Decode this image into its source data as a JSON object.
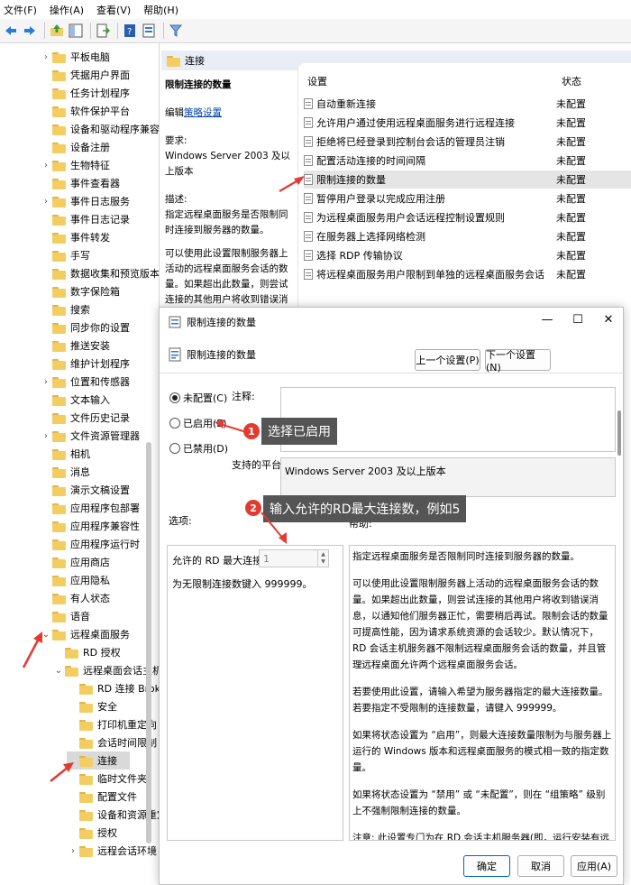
{
  "menu": [
    "文件(F)",
    "操作(A)",
    "查看(V)",
    "帮助(H)"
  ],
  "tree": {
    "items": [
      {
        "label": "平板电脑",
        "expander": "›",
        "level": 1
      },
      {
        "label": "凭据用户界面",
        "expander": "",
        "level": 1
      },
      {
        "label": "任务计划程序",
        "expander": "",
        "level": 1
      },
      {
        "label": "软件保护平台",
        "expander": "",
        "level": 1
      },
      {
        "label": "设备和驱动程序兼容性",
        "expander": "",
        "level": 1
      },
      {
        "label": "设备注册",
        "expander": "",
        "level": 1
      },
      {
        "label": "生物特征",
        "expander": "›",
        "level": 1
      },
      {
        "label": "事件查看器",
        "expander": "",
        "level": 1
      },
      {
        "label": "事件日志服务",
        "expander": "›",
        "level": 1
      },
      {
        "label": "事件日志记录",
        "expander": "",
        "level": 1
      },
      {
        "label": "事件转发",
        "expander": "",
        "level": 1
      },
      {
        "label": "手写",
        "expander": "",
        "level": 1
      },
      {
        "label": "数据收集和预览版本",
        "expander": "",
        "level": 1
      },
      {
        "label": "数字保险箱",
        "expander": "",
        "level": 1
      },
      {
        "label": "搜索",
        "expander": "",
        "level": 1
      },
      {
        "label": "同步你的设置",
        "expander": "",
        "level": 1
      },
      {
        "label": "推送安装",
        "expander": "",
        "level": 1
      },
      {
        "label": "维护计划程序",
        "expander": "",
        "level": 1
      },
      {
        "label": "位置和传感器",
        "expander": "›",
        "level": 1
      },
      {
        "label": "文本输入",
        "expander": "",
        "level": 1
      },
      {
        "label": "文件历史记录",
        "expander": "",
        "level": 1
      },
      {
        "label": "文件资源管理器",
        "expander": "›",
        "level": 1
      },
      {
        "label": "相机",
        "expander": "",
        "level": 1
      },
      {
        "label": "消息",
        "expander": "",
        "level": 1
      },
      {
        "label": "演示文稿设置",
        "expander": "",
        "level": 1
      },
      {
        "label": "应用程序包部署",
        "expander": "",
        "level": 1
      },
      {
        "label": "应用程序兼容性",
        "expander": "",
        "level": 1
      },
      {
        "label": "应用程序运行时",
        "expander": "",
        "level": 1
      },
      {
        "label": "应用商店",
        "expander": "",
        "level": 1
      },
      {
        "label": "应用隐私",
        "expander": "",
        "level": 1
      },
      {
        "label": "有人状态",
        "expander": "",
        "level": 1
      },
      {
        "label": "语音",
        "expander": "",
        "level": 1
      },
      {
        "label": "远程桌面服务",
        "expander": "⌄",
        "level": 1
      },
      {
        "label": "RD 授权",
        "expander": "",
        "level": 2
      },
      {
        "label": "远程桌面会话主机",
        "expander": "⌄",
        "level": 2
      },
      {
        "label": "RD 连接 Broker",
        "expander": "",
        "level": 3
      },
      {
        "label": "安全",
        "expander": "",
        "level": 3
      },
      {
        "label": "打印机重定向",
        "expander": "",
        "level": 3
      },
      {
        "label": "会话时间限制",
        "expander": "",
        "level": 3
      },
      {
        "label": "连接",
        "expander": "",
        "level": 3,
        "selected": true
      },
      {
        "label": "临时文件夹",
        "expander": "",
        "level": 3
      },
      {
        "label": "配置文件",
        "expander": "",
        "level": 3
      },
      {
        "label": "设备和资源重定向",
        "expander": "",
        "level": 3
      },
      {
        "label": "授权",
        "expander": "",
        "level": 3
      },
      {
        "label": "远程会话环境",
        "expander": "›",
        "level": 3
      }
    ]
  },
  "right": {
    "header": "连接",
    "desc": {
      "title": "限制连接的数量",
      "edit_prefix": "编辑",
      "edit_link": "策略设置",
      "req_label": "要求:",
      "req_value": "Windows Server 2003 及以上版本",
      "desc_label": "描述:",
      "desc_text": "指定远程桌面服务是否限制同时连接到服务器的数量。",
      "desc_more": "可以使用此设置限制服务器上活动的远程桌面服务会话的数量。如果超出此数量，则尝试连接的其他用户将收到错误消息，以通知他们服务器正"
    },
    "list": {
      "col_setting": "设置",
      "col_status": "状态",
      "rows": [
        {
          "name": "自动重新连接",
          "status": "未配置"
        },
        {
          "name": "允许用户通过使用远程桌面服务进行远程连接",
          "status": "未配置"
        },
        {
          "name": "拒绝将已经登录到控制台会话的管理员注销",
          "status": "未配置"
        },
        {
          "name": "配置活动连接的时间间隔",
          "status": "未配置"
        },
        {
          "name": "限制连接的数量",
          "status": "未配置",
          "selected": true
        },
        {
          "name": "暂停用户登录以完成应用注册",
          "status": "未配置"
        },
        {
          "name": "为远程桌面服务用户会话远程控制设置规则",
          "status": "未配置"
        },
        {
          "name": "在服务器上选择网络检测",
          "status": "未配置"
        },
        {
          "name": "选择 RDP 传输协议",
          "status": "未配置"
        },
        {
          "name": "将远程桌面服务用户限制到单独的远程桌面服务会话",
          "status": "未配置"
        }
      ]
    }
  },
  "dialog": {
    "title": "限制连接的数量",
    "subtitle": "限制连接的数量",
    "prev_button": "上一个设置(P)",
    "next_button": "下一个设置(N)",
    "radio_not_configured": "未配置(C)",
    "radio_enabled": "已启用(E)",
    "radio_disabled": "已禁用(D)",
    "comment_label": "注释:",
    "platform_label": "支持的平台:",
    "platform_value": "Windows Server 2003 及以上版本",
    "options_label": "选项:",
    "help_label": "帮助:",
    "max_label": "允许的 RD 最大连接数",
    "max_value": "1",
    "unlimited_hint": "为无限制连接数键入 999999。",
    "help_paragraphs": [
      "指定远程桌面服务是否限制同时连接到服务器的数量。",
      "可以使用此设置限制服务器上活动的远程桌面服务会话的数量。如果超出此数量，则尝试连接的其他用户将收到错误消息，以通知他们服务器正忙，需要稍后再试。限制会话的数量可提高性能，因为请求系统资源的会话较少。默认情况下，RD 会话主机服务器不限制远程桌面服务会话的数量，并且管理远程桌面允许两个远程桌面服务会话。",
      "若要使用此设置，请输入希望为服务器指定的最大连接数量。若要指定不受限制的连接数量，请键入 999999。",
      "如果将状态设置为 “启用”，则最大连接数量限制为与服务器上运行的 Windows 版本和远程桌面服务的模式相一致的指定数量。",
      "如果将状态设置为 “禁用” 或 “未配置”，则在 “组策略” 级别上不强制限制连接的数量。",
      "注意: 此设置专门为在 RD 会话主机服务器(即，运行安装有远程桌面会话主机角色服务的 Windows 的服务器)上使用而设计。"
    ],
    "ok_button": "确定",
    "cancel_button": "取消",
    "apply_button": "应用(A)",
    "min_icon": "—",
    "max_icon": "☐",
    "close_icon": "✕"
  },
  "annotations": {
    "step1_number": "1",
    "step1_text": "选择已启用",
    "step2_number": "2",
    "step2_text": "输入允许的RD最大连接数，例如5",
    "color_arrow": "#e23b32"
  }
}
